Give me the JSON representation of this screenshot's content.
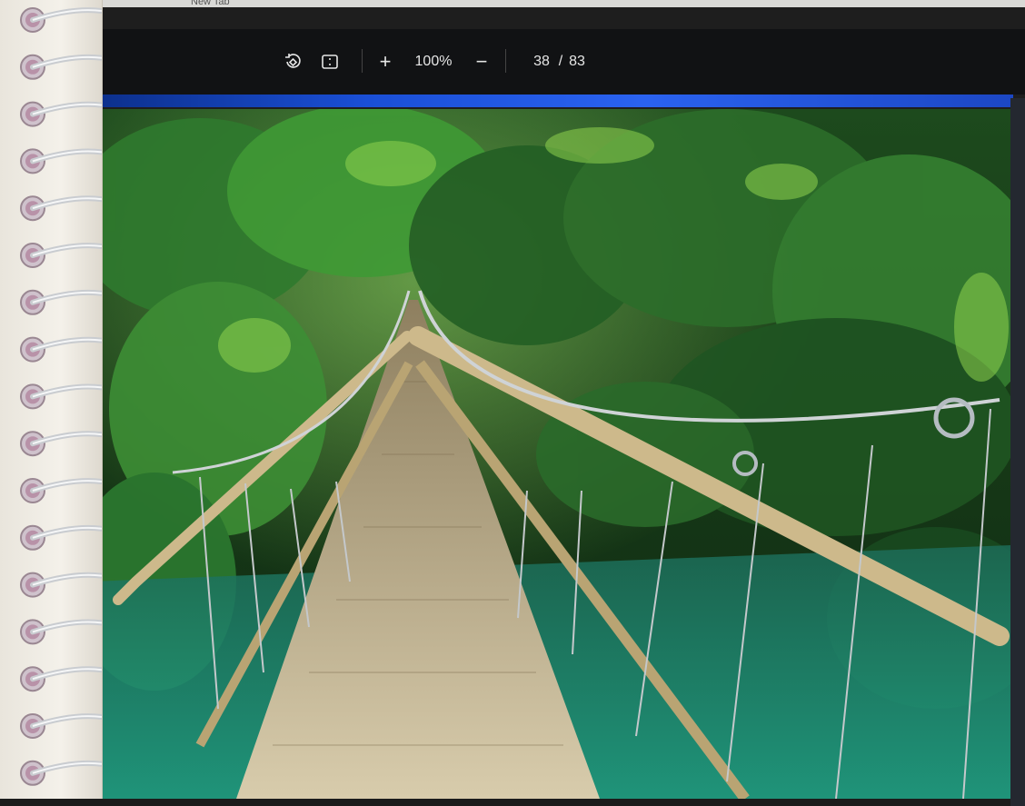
{
  "browser": {
    "tabs": [
      {
        "label": "New Tab"
      },
      {
        "label": ""
      },
      {
        "label": ""
      }
    ]
  },
  "pdf_toolbar": {
    "rotate_icon": "rotate-icon",
    "fit_page_icon": "fit-page-icon",
    "zoom_in_label": "+",
    "zoom_level": "100%",
    "zoom_out_label": "−",
    "current_page": "38",
    "page_separator": "/",
    "total_pages": "83"
  },
  "colors": {
    "toolbar_bg": "#111214",
    "accent_bar": "#2a62f0",
    "foliage": "#2f7a2e",
    "water": "#1f9a86",
    "bamboo": "#cdb98b"
  },
  "photo": {
    "subject": "suspension-bridge"
  }
}
